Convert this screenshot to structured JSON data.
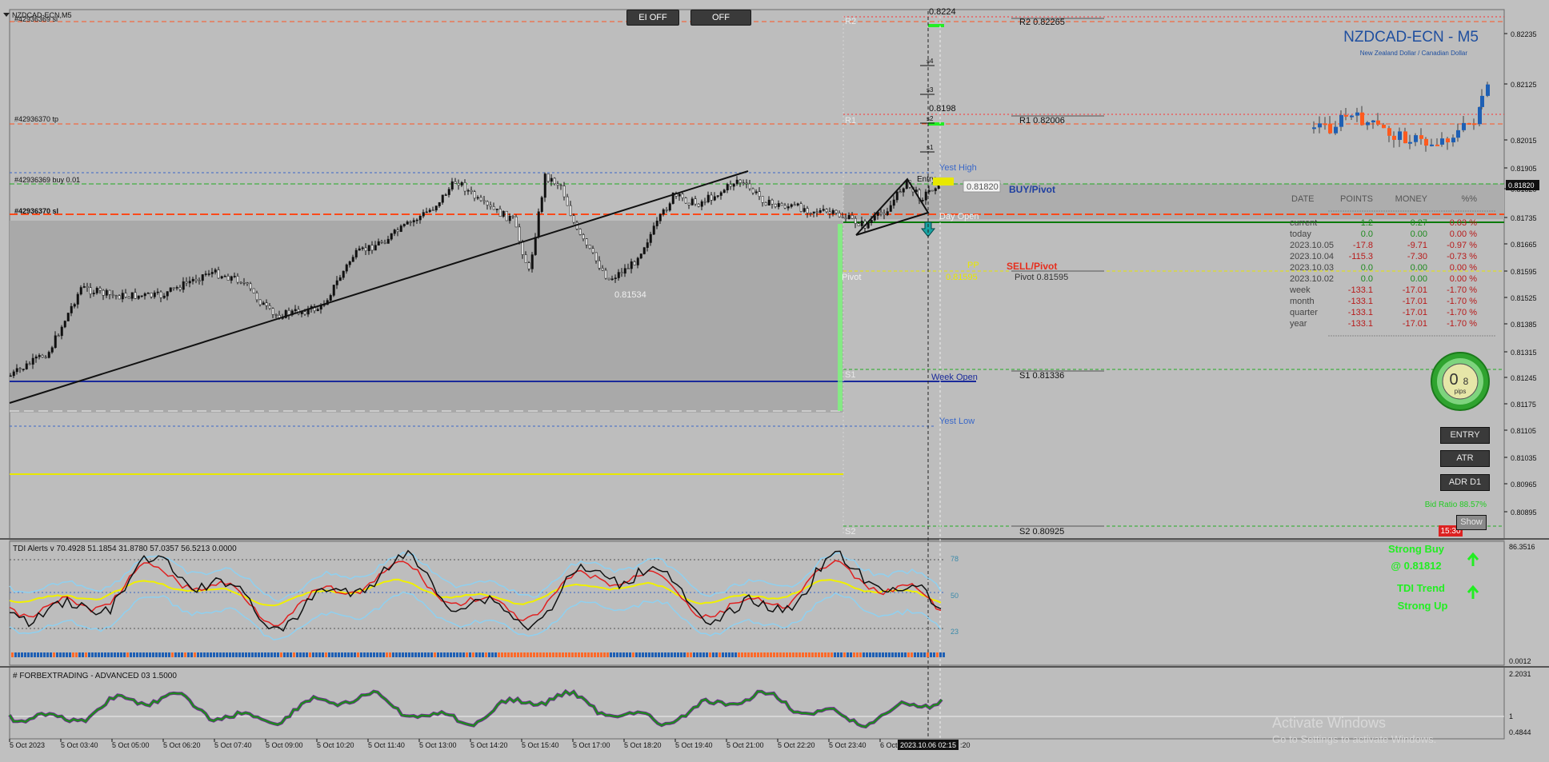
{
  "window": {
    "title": "NZDCAD-ECN,M5"
  },
  "toolbar": {
    "ei_off": "EI OFF",
    "off": "OFF"
  },
  "symbol": {
    "name": "NZDCAD-ECN - M5",
    "description": "New Zealand Dollar / Canadian Dollar"
  },
  "colors": {
    "bg": "#c0c0c0",
    "bull": "#1e5fb4",
    "bear": "#ff5a1e",
    "pivot_green": "#22cc22",
    "buy_label": "#1f3fa0",
    "sell_label": "#e62e1e",
    "strong": "#22ee22"
  },
  "price_axis": {
    "ticks": [
      "0.82235",
      "0.82125",
      "0.82015",
      "0.81905",
      "0.81820",
      "0.81735",
      "0.81665",
      "0.81595",
      "0.81525",
      "0.81385",
      "0.81315",
      "0.81245",
      "0.81175",
      "0.81105",
      "0.81035",
      "0.80965",
      "0.80895"
    ],
    "current_price": "0.81820"
  },
  "order_labels": {
    "sl_top": "#42936369 sl",
    "tp": "#42936370 tp",
    "buy": "#42936369 buy 0.01",
    "sl": "#42936370 sl"
  },
  "levels": {
    "r2_label": "R2",
    "r2_text": "R2 0.82265",
    "r1_label": "R1",
    "r1_text": "R1 0.82006",
    "pivot_label": "Pivot",
    "pivot_text": "Pivot 0.81595",
    "pivot_price": "0.81595",
    "pp_label": "PP",
    "s1_label": "S1",
    "s1_text": "S1 0.81336",
    "s2_label": "S2",
    "s2_text": "S2 0.80925",
    "yest_high": "Yest High",
    "yest_low": "Yest Low",
    "day_open": "Day Open",
    "week_open": "Week Open",
    "entry": "Entry",
    "entry_price": "0.81820",
    "low_mark": "0.81534",
    "top_price": "0.8224",
    "mid_price": "0.8198",
    "buy_pivot": "BUY/Pivot",
    "sell_pivot": "SELL/Pivot",
    "s_marks": [
      "s4",
      "s3",
      "s2",
      "s1"
    ]
  },
  "stats": {
    "headers": [
      "DATE",
      "POINTS",
      "MONEY",
      "%%"
    ],
    "rows": [
      [
        "current",
        "1.2",
        "0.27",
        "0.03 %"
      ],
      [
        "today",
        "0.0",
        "0.00",
        "0.00 %"
      ],
      [
        "2023.10.05",
        "-17.8",
        "-9.71",
        "-0.97 %"
      ],
      [
        "2023.10.04",
        "-115.3",
        "-7.30",
        "-0.73 %"
      ],
      [
        "2023.10.03",
        "0.0",
        "0.00",
        "0.00 %"
      ],
      [
        "2023.10.02",
        "0.0",
        "0.00",
        "0.00 %"
      ],
      [
        "week",
        "-133.1",
        "-17.01",
        "-1.70 %"
      ],
      [
        "month",
        "-133.1",
        "-17.01",
        "-1.70 %"
      ],
      [
        "quarter",
        "-133.1",
        "-17.01",
        "-1.70 %"
      ],
      [
        "year",
        "-133.1",
        "-17.01",
        "-1.70 %"
      ]
    ]
  },
  "gauge": {
    "value": "0.8",
    "int": "0",
    "dec": "8",
    "unit": "pips"
  },
  "side_buttons": {
    "entry": "ENTRY",
    "atr": "ATR",
    "adr": "ADR D1",
    "show": "Show"
  },
  "bid_ratio": "Bid Ratio 88.57%",
  "timer": "15:30",
  "tdi": {
    "title": "TDI Alerts v 70.4928 51.1854 31.8780 57.0357 56.5213 0.0000",
    "axis_top": "86.3516",
    "axis_bottom": "0.0012",
    "level_78": "78",
    "level_50": "50",
    "level_23": "23",
    "signal1": "Strong Buy",
    "signal2": "@ 0.81812",
    "signal3": "TDI Trend",
    "signal4": "Strong Up"
  },
  "fbt": {
    "title": "# FORBEXTRADING - ADVANCED 03 1.5000",
    "axis_top": "2.2031",
    "axis_mid": "1",
    "axis_bottom": "0.4844"
  },
  "time_axis": {
    "labels": [
      "5 Oct 2023",
      "5 Oct 03:40",
      "5 Oct 05:00",
      "5 Oct 06:20",
      "5 Oct 07:40",
      "5 Oct 09:00",
      "5 Oct 10:20",
      "5 Oct 11:40",
      "5 Oct 13:00",
      "5 Oct 14:20",
      "5 Oct 15:40",
      "5 Oct 17:00",
      "5 Oct 18:20",
      "5 Oct 19:40",
      "5 Oct 21:00",
      "5 Oct 22:20",
      "5 Oct 23:40",
      "6 Oct"
    ],
    "cursor": "2023.10.06 02:15",
    "end_tail": ":20"
  },
  "watermark": {
    "line1": "Activate Windows",
    "line2": "Go to Settings to activate Windows."
  }
}
